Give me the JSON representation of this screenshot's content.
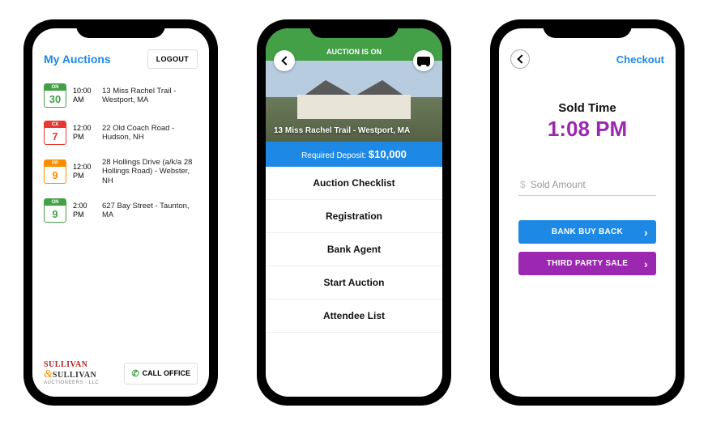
{
  "screen1": {
    "title": "My Auctions",
    "logout": "LOGOUT",
    "rows": [
      {
        "tag": "ON",
        "day": "30",
        "color": "green",
        "time": "10:00 AM",
        "addr": "13 Miss Rachel Trail - Westport, MA"
      },
      {
        "tag": "CX",
        "day": "7",
        "color": "red",
        "time": "12:00 PM",
        "addr": "22 Old Coach Road - Hudson, NH"
      },
      {
        "tag": "PP",
        "day": "9",
        "color": "orange",
        "time": "12:00 PM",
        "addr": "28 Hollings Drive (a/k/a 28 Hollings Road) - Webster, NH"
      },
      {
        "tag": "ON",
        "day": "9",
        "color": "green",
        "time": "2:00 PM",
        "addr": "627 Bay Street - Taunton, MA"
      }
    ],
    "logo": {
      "l1": "SULLIVAN",
      "l2": "SULLIVAN",
      "sub": "AUCTIONEERS · LLC"
    },
    "call": "CALL OFFICE"
  },
  "screen2": {
    "banner": "AUCTION IS ON",
    "address": "13 Miss Rachel Trail - Westport, MA",
    "deposit_label": "Required Deposit:",
    "deposit_amount": "$10,000",
    "menu": [
      "Auction Checklist",
      "Registration",
      "Bank Agent",
      "Start Auction",
      "Attendee List"
    ]
  },
  "screen3": {
    "checkout": "Checkout",
    "sold_label": "Sold Time",
    "sold_time": "1:08 PM",
    "input_placeholder": "Sold Amount",
    "btn1": "BANK BUY BACK",
    "btn2": "THIRD PARTY SALE"
  }
}
